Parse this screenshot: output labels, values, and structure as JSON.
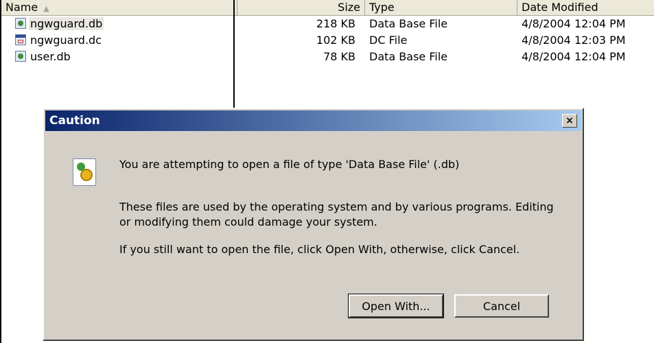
{
  "columns": {
    "name": "Name",
    "size": "Size",
    "type": "Type",
    "date": "Date Modified",
    "sort_indicator": "▲"
  },
  "files": [
    {
      "name": "ngwguard.db",
      "size": "218 KB",
      "type": "Data Base File",
      "date": "4/8/2004 12:04 PM",
      "icon": "database-file-icon"
    },
    {
      "name": "ngwguard.dc",
      "size": "102 KB",
      "type": "DC File",
      "date": "4/8/2004 12:03 PM",
      "icon": "dc-file-icon"
    },
    {
      "name": "user.db",
      "size": "78 KB",
      "type": "Data Base File",
      "date": "4/8/2004 12:04 PM",
      "icon": "database-file-icon"
    }
  ],
  "dialog": {
    "title": "Caution",
    "close_label": "×",
    "message_1": "You are attempting to open a file of type 'Data Base File' (.db)",
    "message_2": "These files are used by the operating system and by various programs. Editing or modifying them could damage your system.",
    "message_3": "If you still want to open the file, click Open With, otherwise, click Cancel.",
    "open_with_label": "Open With...",
    "cancel_label": "Cancel",
    "icon": "caution-file-icon"
  }
}
